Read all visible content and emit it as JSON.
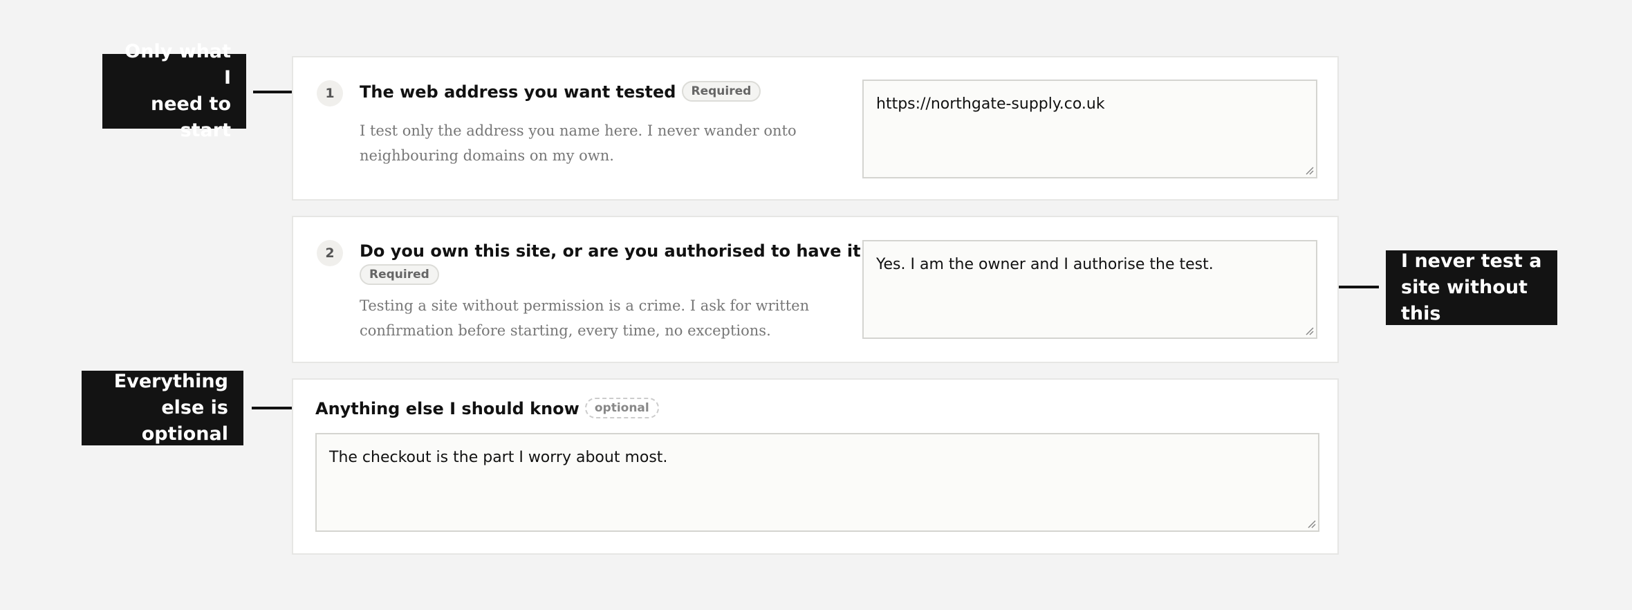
{
  "questions": [
    {
      "number": "1",
      "title": "The web address you want tested",
      "badge": "Required",
      "description_lines": [
        "I test only the address you name here. I never wander onto",
        "neighbouring domains on my own."
      ],
      "value": "https://northgate-supply.co.uk"
    },
    {
      "number": "2",
      "title": "Do you own this site, or are you authorised to have it tested",
      "badge": "Required",
      "description_lines": [
        "Testing a site without permission is a crime. I ask for written",
        "confirmation before starting, every time, no exceptions."
      ],
      "value": "Yes. I am the owner and I authorise the test."
    },
    {
      "title": "Anything else I should know",
      "badge": "optional",
      "value": "The checkout is the part I worry about most."
    }
  ],
  "annotations": {
    "start": [
      "Only what I",
      "need to start"
    ],
    "permission": [
      "I never test a",
      "site without this"
    ],
    "optional": [
      "Everything",
      "else is optional"
    ]
  },
  "colors": {
    "background": "#f3f3f3",
    "card": "#ffffff",
    "annotation_bg": "#131313",
    "field_bg": "#fbfbf9"
  },
  "icons": {
    "resize": "resize-grip-icon",
    "arrow": "arrow-icon"
  }
}
